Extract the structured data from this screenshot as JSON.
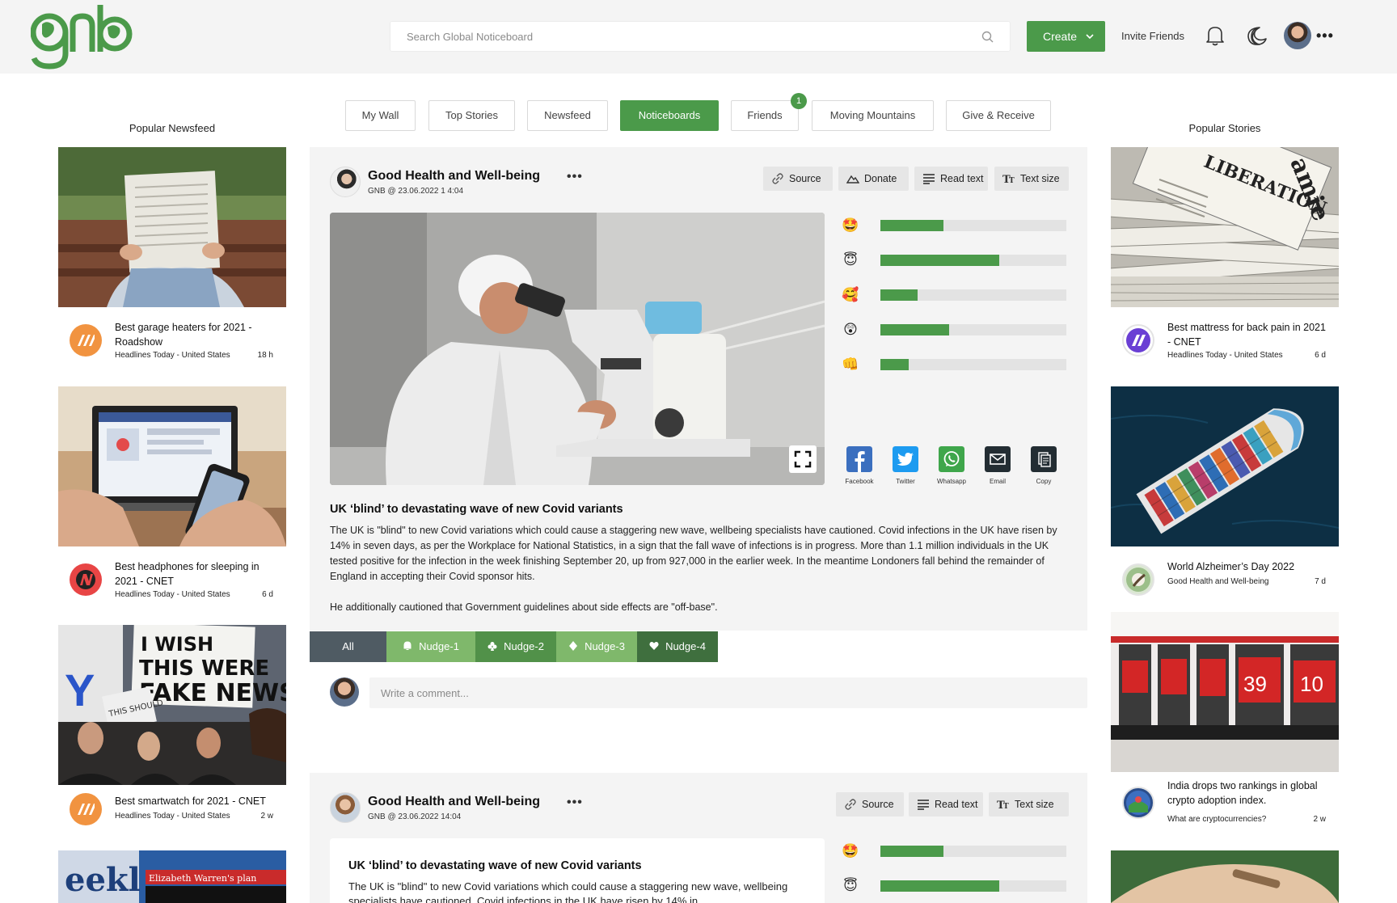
{
  "header": {
    "search_placeholder": "Search Global Noticeboard",
    "create_label": "Create",
    "invite_label": "Invite Friends",
    "accent": "#4b9a4a"
  },
  "tabs": [
    {
      "label": "My Wall"
    },
    {
      "label": "Top Stories"
    },
    {
      "label": "Newsfeed"
    },
    {
      "label": "Noticeboards",
      "active": true
    },
    {
      "label": "Friends",
      "badge": "1"
    },
    {
      "label": "Moving Mountains"
    },
    {
      "label": "Give & Receive"
    }
  ],
  "left_column": {
    "title": "Popular Newsfeed",
    "items": [
      {
        "title": "Best garage heaters for 2021 - Roadshow",
        "source": "Headlines Today - United States",
        "age": "18 h",
        "avatar_color": "#f19340"
      },
      {
        "title": "Best headphones for sleeping in 2021 - CNET",
        "source": "Headlines Today - United States",
        "age": "6 d",
        "avatar_color": "#e84545"
      },
      {
        "title": "Best smartwatch for 2021 - CNET",
        "source": "Headlines Today - United States",
        "age": "2 w",
        "avatar_color": "#f19340"
      }
    ],
    "sign_text": "I WISH THIS WERE FAKE NEWS",
    "sign_sub": "THIS SHOULD PASS",
    "magazine_text": "Elizabeth Warren's plan"
  },
  "right_column": {
    "title": "Popular Stories",
    "items": [
      {
        "title": "Best mattress for back pain in 2021 - CNET",
        "source": "Headlines Today - United States",
        "age": "6 d"
      },
      {
        "title": "World Alzheimer’s Day 2022",
        "source": "Good Health and Well-being",
        "age": "7 d"
      },
      {
        "title": "India drops two rankings in global crypto adoption index.",
        "source": "What are cryptocurrencies?",
        "age": "2 w"
      }
    ],
    "jersey_numbers": [
      "39",
      "10"
    ]
  },
  "post": {
    "title": "Good  Health and Well-being",
    "date": "GNB @ 23.06.2022 1 4:04",
    "buttons": {
      "source": "Source",
      "donate": "Donate",
      "read": "Read text",
      "size": "Text size"
    },
    "reactions": [
      {
        "emoji": "🤩",
        "value": 0.34
      },
      {
        "emoji": "😇",
        "value": 0.64
      },
      {
        "emoji": "🥰",
        "value": 0.2
      },
      {
        "emoji": "😲",
        "value": 0.37
      },
      {
        "emoji": "👊",
        "value": 0.15
      }
    ],
    "share": {
      "facebook": "Facebook",
      "twitter": "Twitter",
      "whatsapp": "Whatsapp",
      "email": "Email",
      "copy": "Copy"
    },
    "article_title": "UK ‘blind’ to devastating wave of new Covid variants",
    "paragraph1": "The UK is \"blind\" to new Covid variations which could cause a staggering new wave, wellbeing specialists have cautioned. Covid infections in the UK have risen by 14% in seven days, as per the Workplace for National Statistics, in a sign that the fall wave of infections is in progress. More than 1.1 million individuals in the UK tested positive for the infection in the week finishing September 20, up from 927,000 in the earlier week. In the meantime Londoners fall behind the remainder of England in accepting their Covid sponsor hits.",
    "paragraph2": "He additionally cautioned that Government guidelines about side effects are \"off-base\".",
    "nudges": [
      {
        "label": "All",
        "color": "#4f5b63"
      },
      {
        "label": "Nudge-1",
        "color": "#7fb86b"
      },
      {
        "label": "Nudge-2",
        "color": "#519149"
      },
      {
        "label": "Nudge-3",
        "color": "#7fb86b"
      },
      {
        "label": "Nudge-4",
        "color": "#3f6f3e"
      }
    ],
    "comment_placeholder": "Write a comment..."
  },
  "post2": {
    "title": "Good  Health and Well-being",
    "date": "GNB @ 23.06.2022 14:04",
    "buttons": {
      "source": "Source",
      "read": "Read text",
      "size": "Text size"
    },
    "reactions": [
      {
        "emoji": "🤩",
        "value": 0.34
      },
      {
        "emoji": "😇",
        "value": 0.64
      }
    ],
    "article_title": "UK ‘blind’ to devastating wave of new Covid variants",
    "body": "The UK is \"blind\" to new Covid variations which could cause a staggering new wave, wellbeing specialists have cautioned. Covid infections in the UK have risen by 14% in"
  }
}
